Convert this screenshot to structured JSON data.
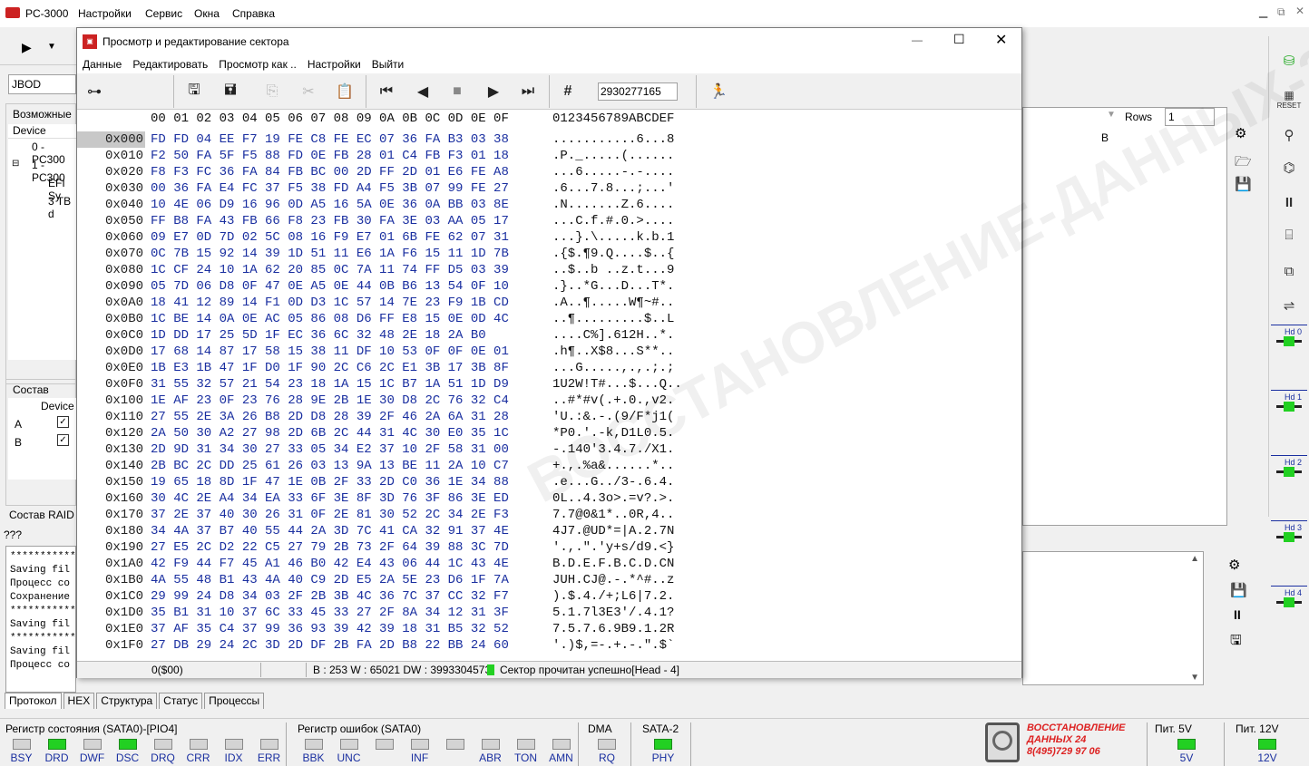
{
  "app": {
    "title": "PC-3000"
  },
  "menu": [
    "Настройки",
    "Сервис",
    "Окна",
    "Справка"
  ],
  "left": {
    "mode_value": "JBOD",
    "group_possible": "Возможные",
    "device_header": "Device",
    "tree": [
      "0 - PC300",
      "1 - PC300",
      "EFI Sy",
      "3 TB d"
    ],
    "raid_group": "Состав RAID",
    "raid_device_header": "Device",
    "raid_rows": [
      {
        "label": "A",
        "checked": true
      },
      {
        "label": "B",
        "checked": true
      }
    ],
    "raid_label2": "Состав RAID",
    "qqq": "???"
  },
  "bg_table": {
    "rows_label": "Rows",
    "rows_value": "1",
    "col_b": "B"
  },
  "log": {
    "lines": [
      "***********",
      "Saving fil",
      "Процесс со",
      "Сохранение",
      "***********",
      "Saving fil",
      "***********",
      "Saving fil",
      "Процесс со"
    ]
  },
  "bottom_tabs": [
    "Протокол",
    "HEX",
    "Структура",
    "Статус",
    "Процессы"
  ],
  "status_register": {
    "title": "Регистр состояния (SATA0)-[PIO4]",
    "leds": [
      {
        "label": "BSY",
        "on": false
      },
      {
        "label": "DRD",
        "on": true
      },
      {
        "label": "DWF",
        "on": false
      },
      {
        "label": "DSC",
        "on": true
      },
      {
        "label": "DRQ",
        "on": false
      },
      {
        "label": "CRR",
        "on": false
      },
      {
        "label": "IDX",
        "on": false
      },
      {
        "label": "ERR",
        "on": false
      }
    ]
  },
  "error_register": {
    "title": "Регистр ошибок  (SATA0)",
    "leds": [
      {
        "label": "BBK",
        "on": false
      },
      {
        "label": "UNC",
        "on": false
      },
      {
        "label": "",
        "on": false
      },
      {
        "label": "INF",
        "on": false
      },
      {
        "label": "",
        "on": false
      },
      {
        "label": "ABR",
        "on": false
      },
      {
        "label": "TON",
        "on": false
      },
      {
        "label": "AMN",
        "on": false
      }
    ]
  },
  "dma": {
    "title": "DMA",
    "label": "RQ",
    "on": false
  },
  "sata2": {
    "title": "SATA-2",
    "label": "PHY",
    "on": true
  },
  "logo": {
    "line1": "ВОССТАНОВЛЕНИЕ",
    "line2": "ДАННЫХ 24",
    "line3": "8(495)729 97 06"
  },
  "power5": {
    "title": "Пит. 5V",
    "label": "5V",
    "on": true
  },
  "power12": {
    "title": "Пит. 12V",
    "label": "12V",
    "on": true
  },
  "right_hd": [
    "Hd 0",
    "Hd 1",
    "Hd 2",
    "Hd 3",
    "Hd 4"
  ],
  "right_reset": "RESET",
  "dialog": {
    "title": "Просмотр и редактирование сектора",
    "menu": [
      "Данные",
      "Редактировать",
      "Просмотр как ..",
      "Настройки",
      "Выйти"
    ],
    "sector_value": "2930277165",
    "header_bytes": "00 01 02 03 04 05 06 07 08 09 0A 0B 0C 0D 0E 0F",
    "header_ascii": "0123456789ABCDEF",
    "rows": [
      {
        "addr": "0x000",
        "bytes": "FD FD 04 EE F7 19 FE C8 FE EC 07 36 FA B3 03 38",
        "ascii": "...........6...8"
      },
      {
        "addr": "0x010",
        "bytes": "F2 50 FA 5F F5 88 FD 0E FB 28 01 C4 FB F3 01 18",
        "ascii": ".P._.....(......"
      },
      {
        "addr": "0x020",
        "bytes": "F8 F3 FC 36 FA 84 FB BC 00 2D FF 2D 01 E6 FE A8",
        "ascii": "...6.....-.-...."
      },
      {
        "addr": "0x030",
        "bytes": "00 36 FA E4 FC 37 F5 38 FD A4 F5 3B 07 99 FE 27",
        "ascii": ".6...7.8...;...'"
      },
      {
        "addr": "0x040",
        "bytes": "10 4E 06 D9 16 96 0D A5 16 5A 0E 36 0A BB 03 8E",
        "ascii": ".N.......Z.6...."
      },
      {
        "addr": "0x050",
        "bytes": "FF B8 FA 43 FB 66 F8 23 FB 30 FA 3E 03 AA 05 17",
        "ascii": "...C.f.#.0.>...."
      },
      {
        "addr": "0x060",
        "bytes": "09 E7 0D 7D 02 5C 08 16 F9 E7 01 6B FE 62 07 31",
        "ascii": "...}.\\.....k.b.1"
      },
      {
        "addr": "0x070",
        "bytes": "0C 7B 15 92 14 39 1D 51 11 E6 1A F6 15 11 1D 7B",
        "ascii": ".{$.¶9.Q....$..{"
      },
      {
        "addr": "0x080",
        "bytes": "1C CF 24 10 1A 62 20 85 0C 7A 11 74 FF D5 03 39",
        "ascii": "..$..b ..z.t...9"
      },
      {
        "addr": "0x090",
        "bytes": "05 7D 06 D8 0F 47 0E A5 0E 44 0B B6 13 54 0F 10",
        "ascii": ".}..*G...D...T*."
      },
      {
        "addr": "0x0A0",
        "bytes": "18 41 12 89 14 F1 0D D3 1C 57 14 7E 23 F9 1B CD",
        "ascii": ".A..¶.....W¶~#.."
      },
      {
        "addr": "0x0B0",
        "bytes": "1C BE 14 0A 0E AC 05 86 08 D6 FF E8 15 0E 0D 4C",
        "ascii": "..¶.........$..L"
      },
      {
        "addr": "0x0C0",
        "bytes": "1D DD 17 25 5D 1F EC 36 6C 32 48 2E 18 2A B0",
        "ascii": "....C%].612H..*."
      },
      {
        "addr": "0x0D0",
        "bytes": "17 68 14 87 17 58 15 38 11 DF 10 53 0F 0F 0E 01",
        "ascii": ".h¶..X$8...S**.."
      },
      {
        "addr": "0x0E0",
        "bytes": "1B E3 1B 47 1F D0 1F 90 2C C6 2C E1 3B 17 3B 8F",
        "ascii": "...G.....,.,.;.;"
      },
      {
        "addr": "0x0F0",
        "bytes": "31 55 32 57 21 54 23 18 1A 15 1C B7 1A 51 1D D9",
        "ascii": "1U2W!T#...$...Q.."
      },
      {
        "addr": "0x100",
        "bytes": "1E AF 23 0F 23 76 28 9E 2B 1E 30 D8 2C 76 32 C4",
        "ascii": "..#*#v(.+.0.,v2."
      },
      {
        "addr": "0x110",
        "bytes": "27 55 2E 3A 26 B8 2D D8 28 39 2F 46 2A 6A 31 28",
        "ascii": "'U.:&.-.(9/F*j1("
      },
      {
        "addr": "0x120",
        "bytes": "2A 50 30 A2 27 98 2D 6B 2C 44 31 4C 30 E0 35 1C",
        "ascii": "*P0.'.-k,D1L0.5."
      },
      {
        "addr": "0x130",
        "bytes": "2D 9D 31 34 30 27 33 05 34 E2 37 10 2F 58 31 00",
        "ascii": "-.140'3.4.7./X1."
      },
      {
        "addr": "0x140",
        "bytes": "2B BC 2C DD 25 61 26 03 13 9A 13 BE 11 2A 10 C7",
        "ascii": "+.,.%a&......*.."
      },
      {
        "addr": "0x150",
        "bytes": "19 65 18 8D 1F 47 1E 0B 2F 33 2D C0 36 1E 34 88",
        "ascii": ".e...G../3-.6.4."
      },
      {
        "addr": "0x160",
        "bytes": "30 4C 2E A4 34 EA 33 6F 3E 8F 3D 76 3F 86 3E ED",
        "ascii": "0L..4.3o>.=v?.>."
      },
      {
        "addr": "0x170",
        "bytes": "37 2E 37 40 30 26 31 0F 2E 81 30 52 2C 34 2E F3",
        "ascii": "7.7@0&1*..0R,4.."
      },
      {
        "addr": "0x180",
        "bytes": "34 4A 37 B7 40 55 44 2A 3D 7C 41 CA 32 91 37 4E",
        "ascii": "4J7.@UD*=|A.2.7N"
      },
      {
        "addr": "0x190",
        "bytes": "27 E5 2C D2 22 C5 27 79 2B 73 2F 64 39 88 3C 7D",
        "ascii": "'.,.\".'y+s/d9.<}"
      },
      {
        "addr": "0x1A0",
        "bytes": "42 F9 44 F7 45 A1 46 B0 42 E4 43 06 44 1C 43 4E",
        "ascii": "B.D.E.F.B.C.D.CN"
      },
      {
        "addr": "0x1B0",
        "bytes": "4A 55 48 B1 43 4A 40 C9 2D E5 2A 5E 23 D6 1F 7A",
        "ascii": "JUH.CJ@.-.*^#..z"
      },
      {
        "addr": "0x1C0",
        "bytes": "29 99 24 D8 34 03 2F 2B 3B 4C 36 7C 37 CC 32 F7",
        "ascii": ").$.4./+;L6|7.2."
      },
      {
        "addr": "0x1D0",
        "bytes": "35 B1 31 10 37 6C 33 45 33 27 2F 8A 34 12 31 3F",
        "ascii": "5.1.7l3E3'/.4.1?"
      },
      {
        "addr": "0x1E0",
        "bytes": "37 AF 35 C4 37 99 36 93 39 42 39 18 31 B5 32 52",
        "ascii": "7.5.7.6.9B9.1.2R"
      },
      {
        "addr": "0x1F0",
        "bytes": "27 DB 29 24 2C 3D 2D DF 2B FA 2D B8 22 BB 24 60",
        "ascii": "'.)$,=-.+.-.\".$`"
      }
    ],
    "status_offset": "0($00)",
    "status_values": "B : 253 W : 65021 DW : 3993304573",
    "status_message": "Сектор прочитан успешно[Head - 4]"
  }
}
